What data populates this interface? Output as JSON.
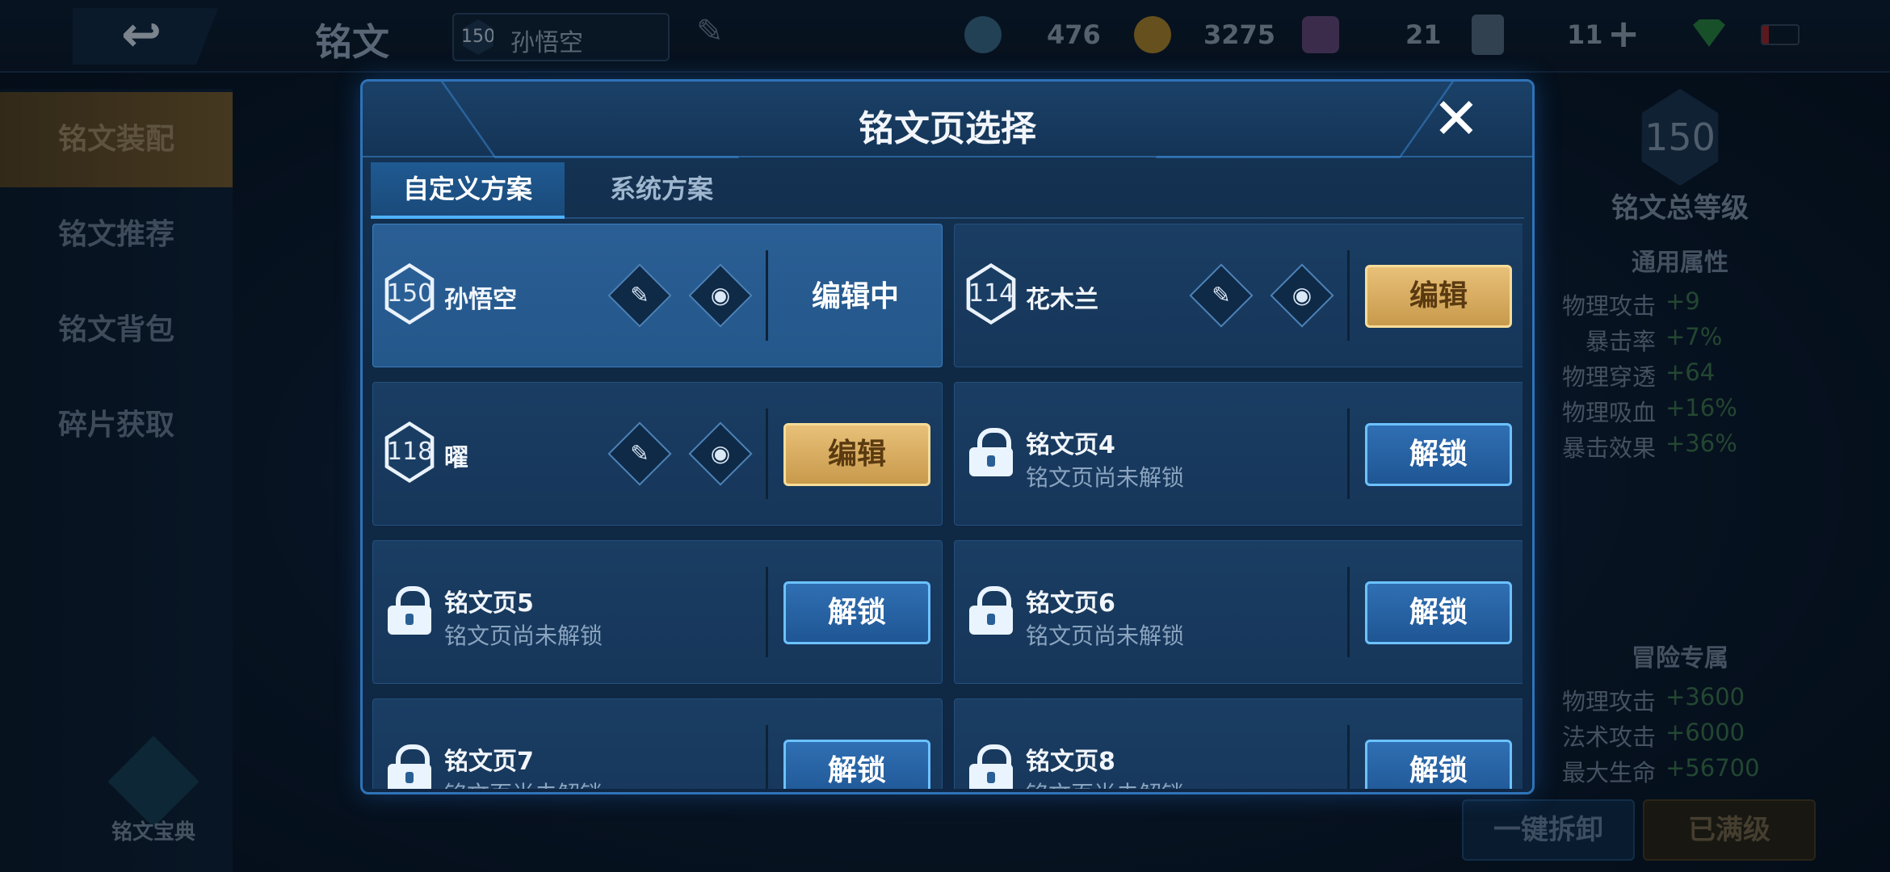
{
  "header": {
    "page_title": "铭文",
    "hero_level": "150",
    "hero_name": "孙悟空",
    "resources": [
      {
        "icon": "diamond-gem-icon",
        "value": "476",
        "color": "#3c6f8f"
      },
      {
        "icon": "gold-coin-icon",
        "value": "3275",
        "color": "#b88a2a"
      },
      {
        "icon": "crystal-icon",
        "value": "21",
        "color": "#6b4a7e"
      },
      {
        "icon": "voucher-card-icon",
        "value": "11",
        "color": "#5a6f86"
      }
    ]
  },
  "sidebar": {
    "items": [
      {
        "label": "铭文装配",
        "active": true
      },
      {
        "label": "铭文推荐",
        "active": false
      },
      {
        "label": "铭文背包",
        "active": false
      },
      {
        "label": "碎片获取",
        "active": false
      }
    ],
    "bottom_label": "铭文宝典"
  },
  "right_panel": {
    "level": "150",
    "title": "铭文总等级",
    "general_title": "通用属性",
    "general_stats": [
      {
        "k": "物理攻击",
        "v": "+9"
      },
      {
        "k": "暴击率",
        "v": "+7%"
      },
      {
        "k": "物理穿透",
        "v": "+64"
      },
      {
        "k": "物理吸血",
        "v": "+16%"
      },
      {
        "k": "暴击效果",
        "v": "+36%"
      }
    ],
    "adventure_title": "冒险专属",
    "adventure_stats": [
      {
        "k": "物理攻击",
        "v": "+3600"
      },
      {
        "k": "法术攻击",
        "v": "+6000"
      },
      {
        "k": "最大生命",
        "v": "+56700"
      }
    ],
    "btn_unload": "一键拆卸",
    "btn_full": "已满级"
  },
  "modal": {
    "title": "铭文页选择",
    "tabs": [
      "自定义方案",
      "系统方案"
    ],
    "pages": [
      {
        "level": "150",
        "hero": "孙悟空",
        "status": "编辑中"
      },
      {
        "level": "114",
        "hero": "花木兰",
        "button": "编辑"
      },
      {
        "level": "118",
        "hero": "曜",
        "button": "编辑"
      },
      {
        "title": "铭文页4",
        "sub": "铭文页尚未解锁",
        "button": "解锁"
      },
      {
        "title": "铭文页5",
        "sub": "铭文页尚未解锁",
        "button": "解锁"
      },
      {
        "title": "铭文页6",
        "sub": "铭文页尚未解锁",
        "button": "解锁"
      },
      {
        "title": "铭文页7",
        "sub": "铭文页尚未解锁",
        "button": "解锁"
      },
      {
        "title": "铭文页8",
        "sub": "铭文页尚未解锁",
        "button": "解锁"
      }
    ]
  },
  "icons": {
    "close": "✕",
    "back": "↩",
    "pencil": "✎",
    "eye": "◉",
    "plus": "+",
    "wifi": "wifi-icon",
    "battery": "battery-low-icon"
  }
}
